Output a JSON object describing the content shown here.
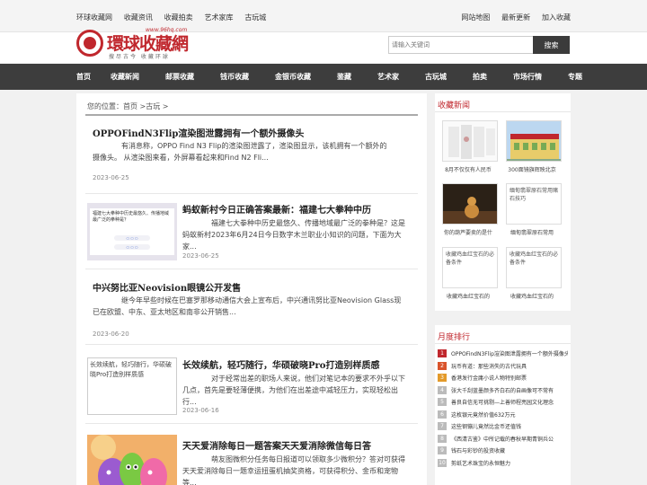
{
  "topbar": {
    "left_links": [
      "环球收藏网",
      "收藏资讯",
      "收藏拍卖",
      "艺术家库",
      "古玩城"
    ],
    "right_links": [
      "网站地图",
      "最新更新",
      "加入收藏"
    ]
  },
  "logo": {
    "name": "環球收藏網",
    "url": "www.96hq.com",
    "slogan": "搜尽古今 收藏环球"
  },
  "search": {
    "placeholder": "请输入关键词",
    "button": "搜索"
  },
  "nav": [
    "首页",
    "收藏新闻",
    "邮票收藏",
    "钱币收藏",
    "金银币收藏",
    "鉴藏",
    "艺术家",
    "古玩城",
    "拍卖",
    "市场行情",
    "专题"
  ],
  "breadcrumb": "您的位置：首页 >古玩 >",
  "articles": [
    {
      "title": "OPPOFindN3Flip渲染图泄露拥有一个额外摄像头",
      "summary": "有消息称，OPPO Find N3 Flip的渲染图泄露了，渲染图显示，该机拥有一个额外的摄像头。  从渲染图来看，外屏幕看起来和Find N2 Fli...",
      "date": "2023-06-25"
    },
    {
      "title": "蚂蚁新村今日正确答案最新：福建七大拳种中历",
      "summary": "福建七大拳种中历史最悠久、传播地域最广泛的拳种是？这是蚂蚁新村2023年6月24日今日数字木兰职业小知识的问题，下面为大家...",
      "date": "2023-06-25",
      "thumb_text": "福建七大拳种中历史最悠久、传播地域最广泛的拳种是？"
    },
    {
      "title": "中兴努比亚Neovision眼镜公开发售",
      "summary": "继今年早些时候在巴塞罗那移动通信大会上宣布后，中兴通讯努比亚Neovision Glass现已在欧盟、中东、亚太地区和南非公开销售...",
      "date": "2023-06-20"
    },
    {
      "title": "长效续航，轻巧随行，华硕破晓Pro打造别样质感",
      "summary": "对于经常出差的职场人来说，他们对笔记本的要求不外乎以下几点，首先是要轻薄便携，为他们在出差途中减轻压力，实现轻松出行...",
      "date": "2023-06-16",
      "thumb_alt": "长效续航，轻巧随行，华硕破晓Pro打造别样质感"
    },
    {
      "title": "天天爱消除每日一题答案天天爱消除微信每日答",
      "summary": "萌友图微积分任务每日报道可以领取多少微积分？答对可获得天天爱消除每日一题幸运扭蛋机抽奖资格，可获得积分、金币和宠物等...",
      "date": ""
    }
  ],
  "sidebar_news": {
    "heading": "收藏新闻",
    "items": [
      {
        "caption": "8月不仅仅有人民币"
      },
      {
        "caption": "300面镜旗辉映北京"
      },
      {
        "caption": "你的葫芦要卖的是什"
      },
      {
        "caption": "缅甸翡翠原石常用",
        "alt": "缅甸翡翠原石常用赌石技巧"
      },
      {
        "caption": "收藏鸡血红宝石的",
        "alt": "收藏鸡血红宝石的必备条件"
      },
      {
        "caption": "收藏鸡血红宝石的",
        "alt": "收藏鸡血红宝石的必备条件"
      }
    ]
  },
  "ranking": {
    "heading": "月度排行",
    "items": [
      "OPPOFindN3Flip渲染图泄露拥有一个额外摄像头",
      "玩币有道：那些消失的古代玩具",
      "香港发行金庸小说人物特别邮票",
      "张大千刮蓝墨颜多齐白石的自画像可不常有",
      "善良自信无可挑剔—上善师程亮园文化理念",
      "这枚银元竟然价值632万元",
      "这些钢镚儿竟然比金币还值钱",
      "《西清古鉴》中所记载的春秋早期青铜兵公",
      "钱石与彩钞的投资收藏",
      "剪纸艺术珠宝的永恒魅力"
    ]
  },
  "colors": {
    "accent": "#c0272d",
    "nav_bg": "#3d3d3d",
    "page_bg": "#f1f1f1"
  }
}
